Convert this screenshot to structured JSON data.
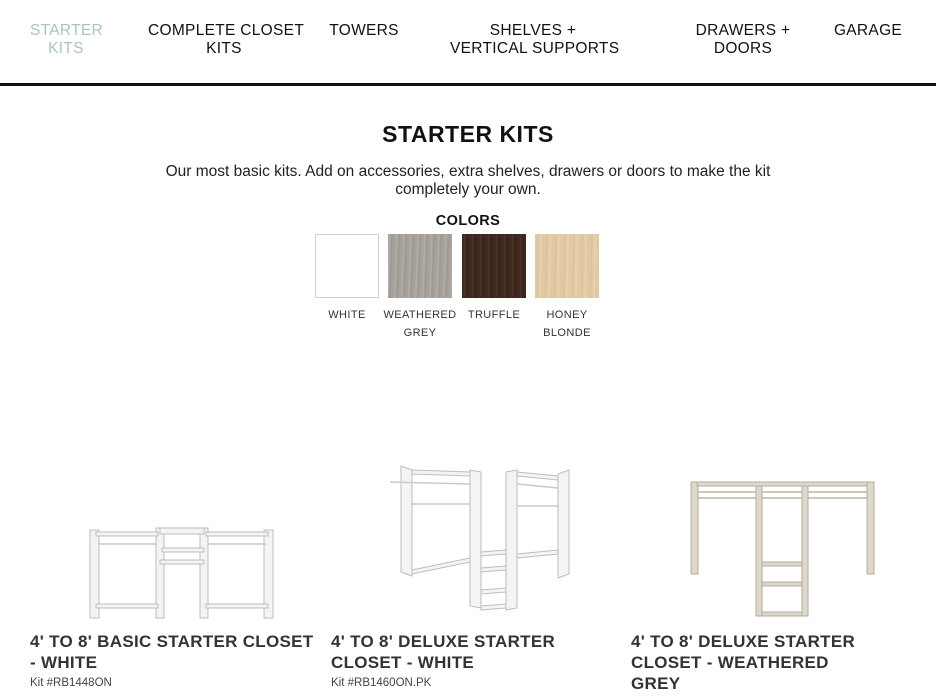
{
  "nav": {
    "items": [
      {
        "line1": "STARTER",
        "line2": "KITS"
      },
      {
        "line1": "COMPLETE CLOSET",
        "line2": "KITS"
      },
      {
        "line1": "TOWERS",
        "line2": ""
      },
      {
        "line1": "SHELVES +",
        "line2": "VERTICAL SUPPORTS"
      },
      {
        "line1": "DRAWERS +",
        "line2": "DOORS"
      },
      {
        "line1": "GARAGE",
        "line2": ""
      }
    ],
    "active_color": "#a9c4c0"
  },
  "hero": {
    "title": "STARTER KITS",
    "description": "Our most basic kits. Add on accessories, extra shelves, drawers or doors to make the kit completely your own.",
    "colors_label": "COLORS"
  },
  "colors": [
    {
      "label_line1": "WHITE",
      "label_line2": "",
      "hex": "#ffffff"
    },
    {
      "label_line1": "WEATHERED",
      "label_line2": "GREY",
      "hex": "#a7a39d"
    },
    {
      "label_line1": "TRUFFLE",
      "label_line2": "",
      "hex": "#3e2a20"
    },
    {
      "label_line1": "HONEY",
      "label_line2": "BLONDE",
      "hex": "#e2cba4"
    }
  ],
  "products": [
    {
      "title": "4' TO 8' BASIC STARTER CLOSET - WHITE",
      "sku": "Kit #RB1448ON",
      "image": "basic-starter-closet-white-icon"
    },
    {
      "title": "4' TO 8' DELUXE STARTER CLOSET - WHITE",
      "sku": "Kit #RB1460ON.PK",
      "image": "deluxe-starter-closet-white-icon"
    },
    {
      "title": "4' TO 8' DELUXE STARTER CLOSET - WEATHERED GREY",
      "sku": "",
      "image": "deluxe-starter-closet-grey-icon"
    }
  ]
}
